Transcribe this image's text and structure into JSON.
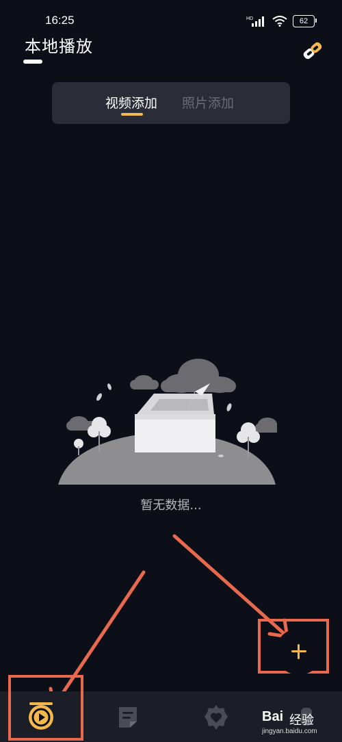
{
  "status_bar": {
    "time": "16:25",
    "network_label": "HD",
    "battery": "62",
    "icons": [
      "signal-icon",
      "wifi-icon",
      "battery-icon"
    ]
  },
  "header": {
    "title": "本地播放",
    "link_icon": "link-icon"
  },
  "tabs": [
    {
      "label": "视频添加",
      "active": true
    },
    {
      "label": "照片添加",
      "active": false
    }
  ],
  "empty_state": {
    "text": "暂无数据..."
  },
  "fab": {
    "icon": "plus-icon"
  },
  "bottom_nav": {
    "items": [
      {
        "icon": "play-icon",
        "active": true
      },
      {
        "icon": "notes-icon",
        "active": false
      },
      {
        "icon": "heart-icon",
        "active": false
      },
      {
        "icon": "profile-icon",
        "active": false
      }
    ]
  },
  "watermark": {
    "logo": "Bai",
    "text": "经验",
    "url": "jingyan.baidu.com"
  },
  "colors": {
    "background": "#0c0e18",
    "accent": "#f5b84d",
    "annotation": "#e8694d",
    "tab_bg": "#2a2c37",
    "nav_bg": "#1c1e27"
  }
}
